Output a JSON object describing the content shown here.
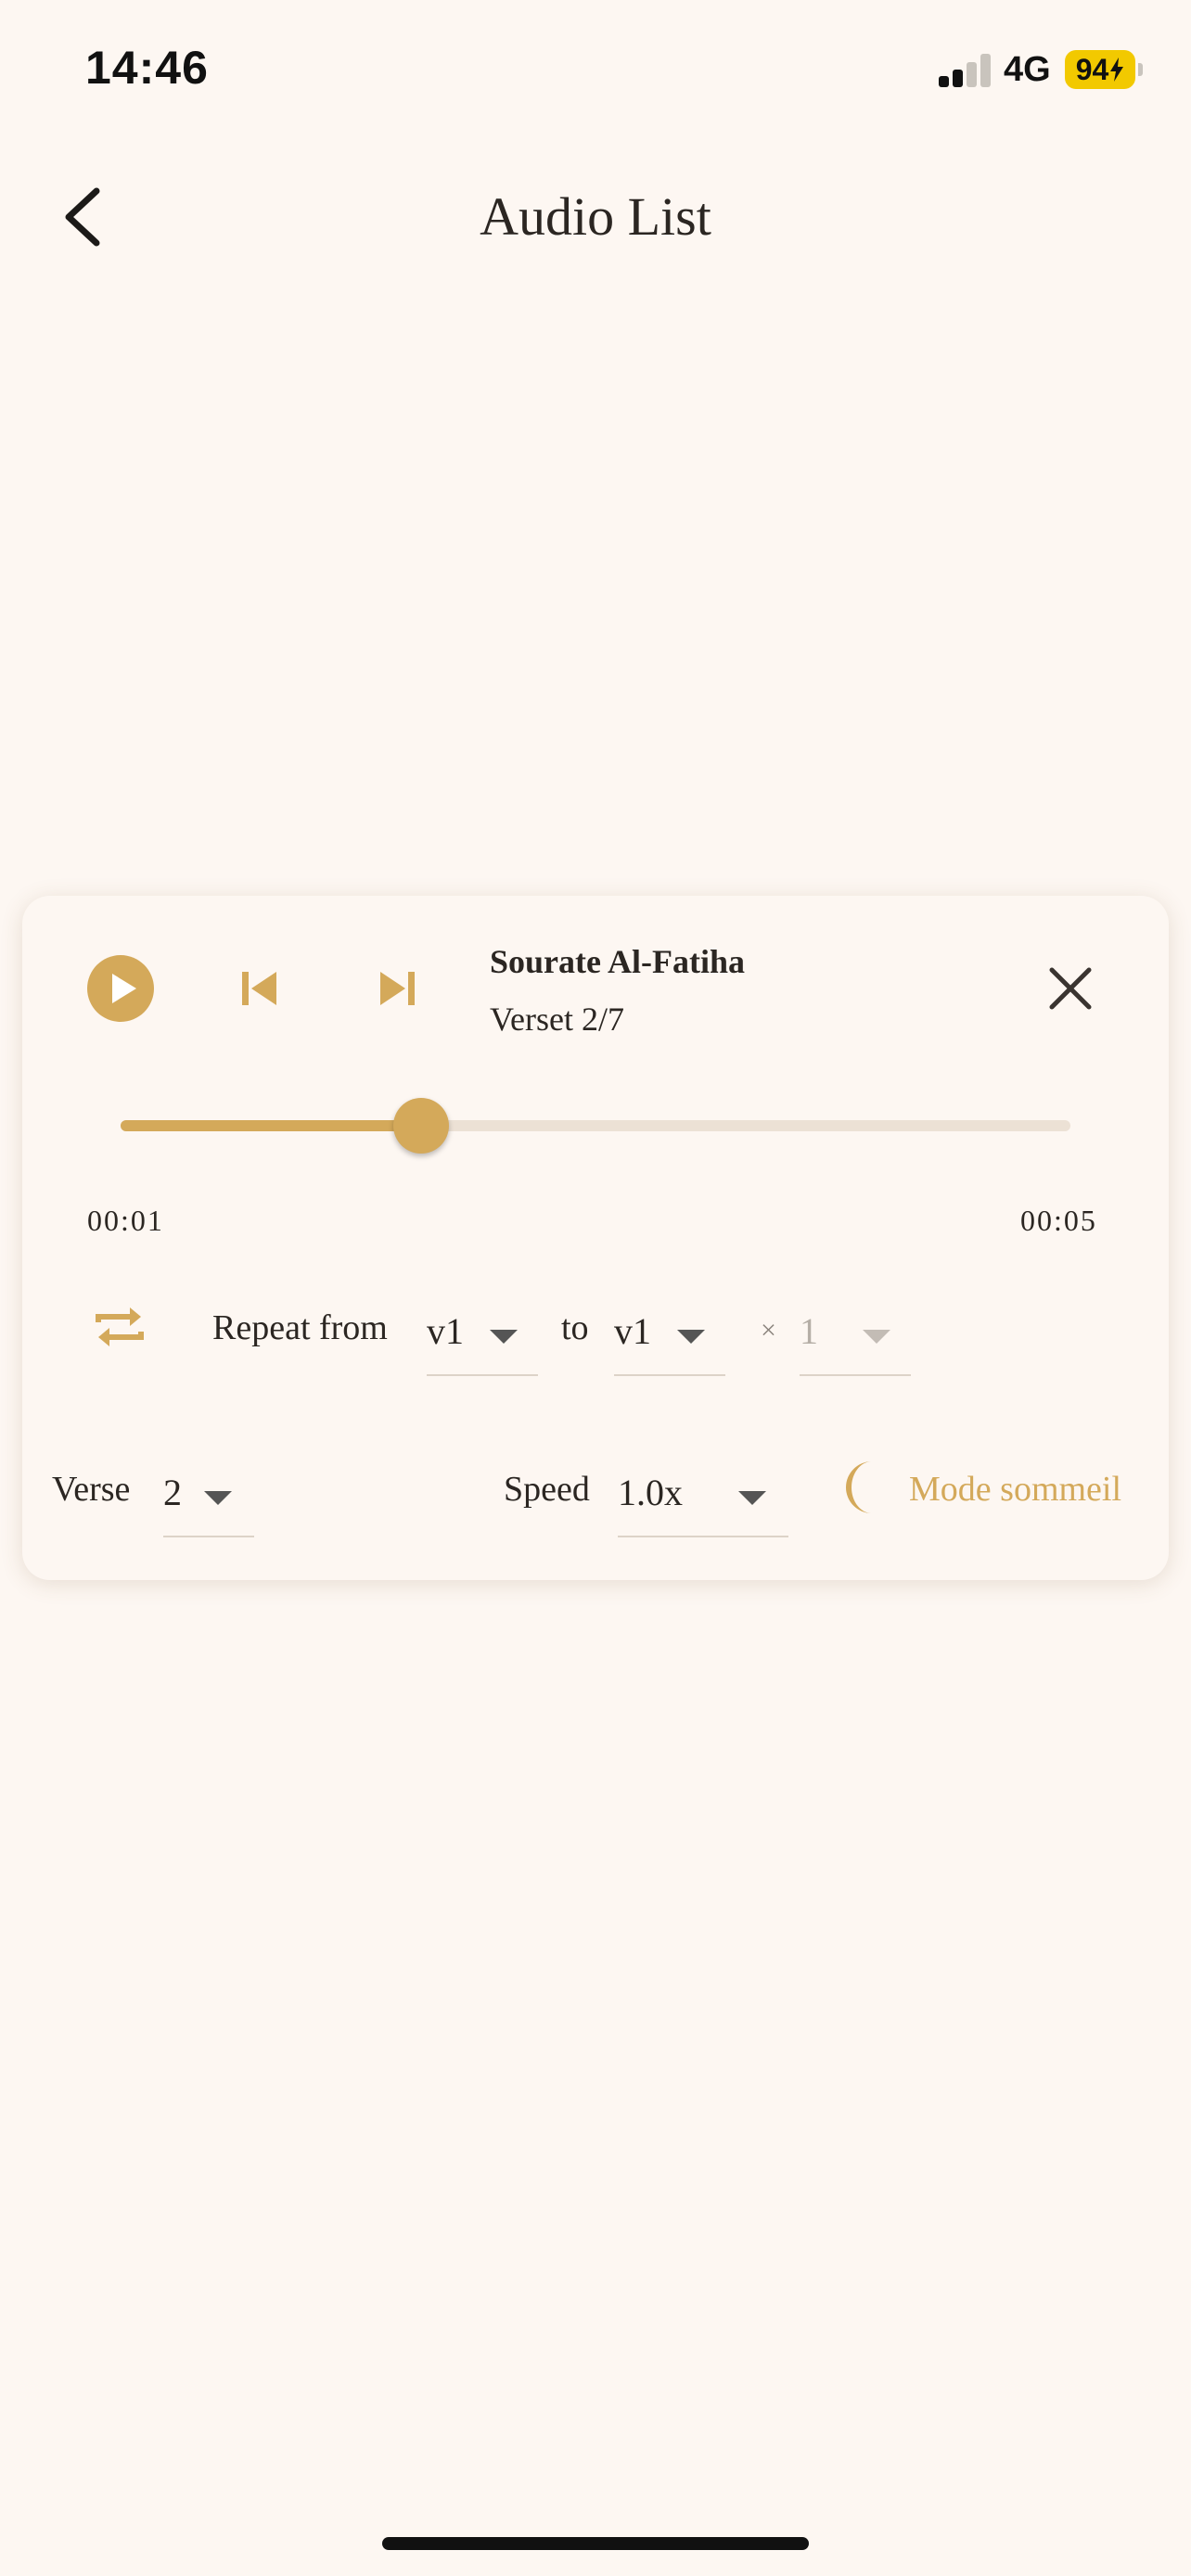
{
  "status_bar": {
    "time": "14:46",
    "network": "4G",
    "battery": "94"
  },
  "header": {
    "title": "Audio List"
  },
  "player": {
    "surah_title": "Sourate Al-Fatiha",
    "verse_info": "Verset 2/7",
    "progress_fraction": 0.316,
    "elapsed": "00:01",
    "duration": "00:05",
    "repeat": {
      "from_label": "Repeat from",
      "from_value": "v1",
      "to_label": "to",
      "to_value": "v1",
      "times_sign": "×",
      "count_value": "1"
    },
    "verse_label": "Verse",
    "verse_value": "2",
    "speed_label": "Speed",
    "speed_value": "1.0x",
    "sleep_mode_label": "Mode sommeil"
  },
  "colors": {
    "accent": "#d4a95a",
    "background": "#fdf7f2",
    "text": "#2b2622"
  },
  "icons": {
    "back": "chevron-left-icon",
    "play": "play-icon",
    "previous": "skip-previous-icon",
    "next": "skip-next-icon",
    "close": "close-icon",
    "repeat": "repeat-icon",
    "sleep": "moon-icon"
  }
}
